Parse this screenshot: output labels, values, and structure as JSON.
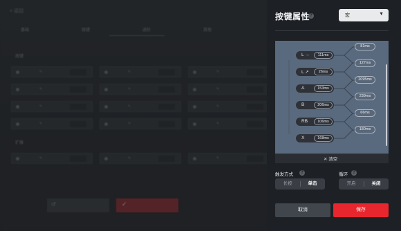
{
  "background": {
    "back_label": "< 返回",
    "tabs": [
      "基础",
      "按键",
      "进阶",
      "其他"
    ],
    "section_main": "按键",
    "section_ext": "扩展",
    "reset_button": "恢复默认",
    "apply_button": "保存配置"
  },
  "panel": {
    "title": "按键属性",
    "mode_select": {
      "value": "宏",
      "caret": "▼"
    },
    "macro": {
      "keys": [
        {
          "name": "L →",
          "duration": "111ms"
        },
        {
          "name": "L ↗",
          "duration": "26ms"
        },
        {
          "name": "A",
          "duration": "153ms"
        },
        {
          "name": "B",
          "duration": "206ms"
        },
        {
          "name": "RB",
          "duration": "106ms"
        },
        {
          "name": "X",
          "duration": "168ms"
        }
      ],
      "gaps": [
        "81ms",
        "127ms",
        "2095ms",
        "239ms",
        "66ms",
        "180ms"
      ],
      "clear_label": "清空",
      "clear_icon": "✕"
    },
    "trigger": {
      "label": "触发方式",
      "options": [
        "长按",
        "单击"
      ],
      "selected": "单击"
    },
    "loop": {
      "label": "循环",
      "options": [
        "开启",
        "关闭"
      ],
      "selected": "关闭"
    },
    "cancel_button": "取消",
    "save_button": "保存",
    "help_glyph": "?"
  },
  "colors": {
    "accent_red": "#e8262d",
    "panel_bg": "#1d2024",
    "macro_bg": "#5a6a7e"
  }
}
